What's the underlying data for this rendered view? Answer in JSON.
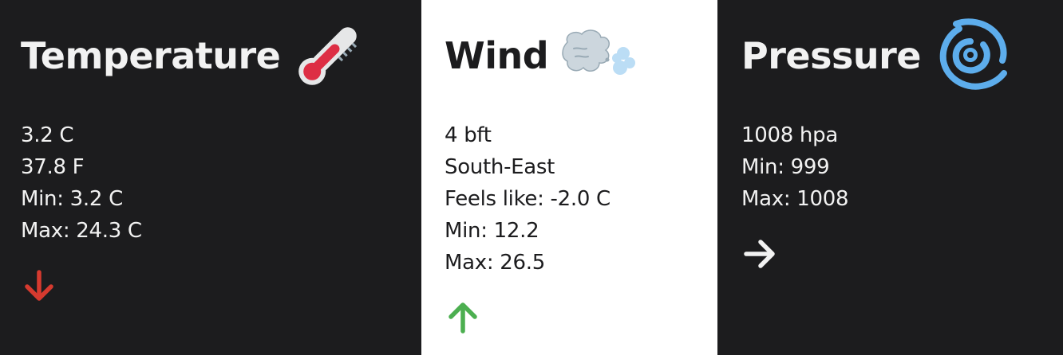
{
  "cards": {
    "temperature": {
      "title": "Temperature",
      "icon": "thermometer-icon",
      "lines": [
        "3.2 C",
        "37.8 F",
        "Min: 3.2 C",
        "Max: 24.3 C"
      ],
      "trend": "down",
      "trend_color": "#d63a2f"
    },
    "wind": {
      "title": "Wind",
      "icon": "wind-face-icon",
      "lines": [
        "4 bft",
        "South-East",
        "Feels like: -2.0 C",
        "Min: 12.2",
        "Max: 26.5"
      ],
      "trend": "up",
      "trend_color": "#4caf50"
    },
    "pressure": {
      "title": "Pressure",
      "icon": "cyclone-icon",
      "lines": [
        "1008 hpa",
        "Min: 999",
        "Max: 1008"
      ],
      "trend": "steady",
      "trend_color": "#f2f2f2"
    }
  },
  "colors": {
    "dark_bg": "#1c1c1e",
    "light_bg": "#ffffff",
    "dark_text": "#1c1c1e",
    "light_text": "#f2f2f2"
  }
}
